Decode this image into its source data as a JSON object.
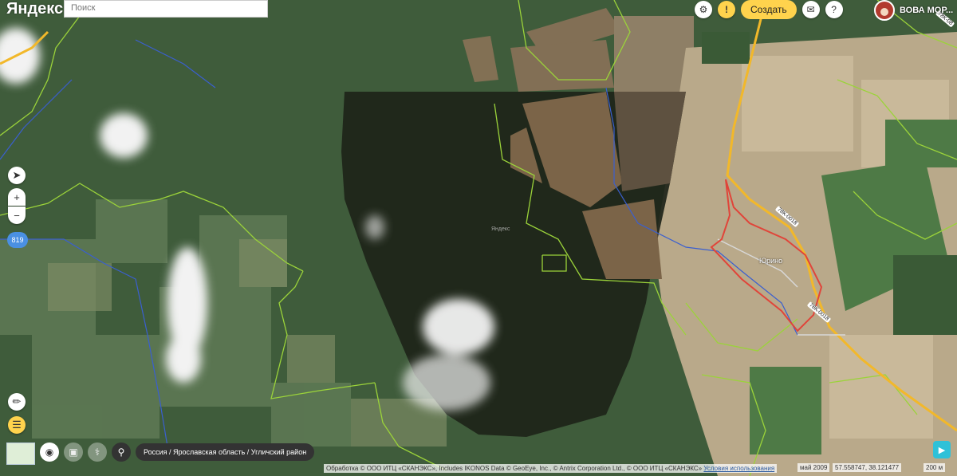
{
  "header": {
    "logo": "Яндекс",
    "search_placeholder": "Поиск",
    "create_label": "Создать",
    "user_name": "ВОВА МОР..."
  },
  "icons": {
    "settings": "gear-icon",
    "warning": "!",
    "feedback": "message-icon",
    "help": "?"
  },
  "left_controls": {
    "zoom_in": "+",
    "zoom_out": "−",
    "zoom_level": "819"
  },
  "map": {
    "place_label": "Юрино",
    "watermark": "Яндекс",
    "road_labels": [
      "78К-0018",
      "78К-0018",
      "78К-08"
    ]
  },
  "footer": {
    "breadcrumb": "Россия / Ярославская область / Угличский район",
    "attribution": "Обработка © ООО ИТЦ «СКАНЭКС», Includes IKONOS Data © GeoEye, Inc., © Antrix Corporation Ltd., © ООО ИТЦ «СКАНЭКС»",
    "terms_link": "Условия использования",
    "imagery_date": "май 2009",
    "coordinates": "57.558747, 38.121477",
    "scale": "200 м"
  },
  "colors": {
    "accent": "#ffd34d",
    "boundary": "#9bd33a",
    "river": "#3a5fd0",
    "road": "#f2b82a",
    "village_outline": "#e0453a"
  }
}
